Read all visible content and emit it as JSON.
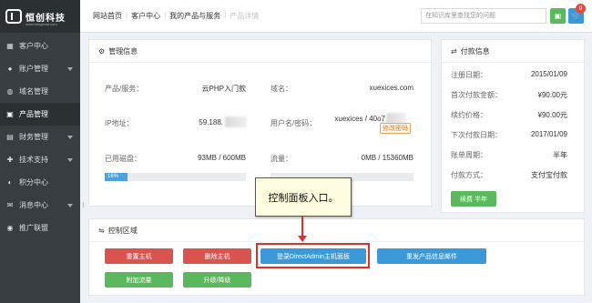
{
  "logo": {
    "title": "恒创科技",
    "subtitle": "www.henghost.com"
  },
  "nav": [
    {
      "label": "客户中心",
      "icon": "grid-icon",
      "glyph": "▦",
      "caret": false,
      "active": false
    },
    {
      "label": "账户管理",
      "icon": "user-icon",
      "glyph": "●",
      "caret": true,
      "active": false
    },
    {
      "label": "域名管理",
      "icon": "globe-icon",
      "glyph": "◍",
      "caret": false,
      "active": false
    },
    {
      "label": "产品管理",
      "icon": "box-icon",
      "glyph": "▣",
      "caret": false,
      "active": true
    },
    {
      "label": "财务管理",
      "icon": "wallet-icon",
      "glyph": "▤",
      "caret": true,
      "active": false
    },
    {
      "label": "技术支持",
      "icon": "support-icon",
      "glyph": "✚",
      "caret": true,
      "active": false
    },
    {
      "label": "积分中心",
      "icon": "points-icon",
      "glyph": "◐",
      "caret": false,
      "active": false
    },
    {
      "label": "消息中心",
      "icon": "message-icon",
      "glyph": "✉",
      "caret": true,
      "active": false
    },
    {
      "label": "推广联盟",
      "icon": "promo-icon",
      "glyph": "◉",
      "caret": false,
      "active": false
    }
  ],
  "breadcrumb": [
    "网站首页",
    "客户中心",
    "我的产品与服务",
    "产品详情"
  ],
  "search": {
    "placeholder": "在知识库里查找您的问题"
  },
  "cart_count": "0",
  "mgmt": {
    "title": "管理信息",
    "product_label": "产品/服务：",
    "product_value": "云PHP入门款",
    "domain_label": "域名：",
    "domain_value": "xuexices.com",
    "ip_label": "IP地址：",
    "ip_value": "59.188.",
    "user_label": "用户名/密码：",
    "user_value": "xuexices / 40o7",
    "change_pwd": "修改密码",
    "disk_label": "已用磁盘：",
    "disk_value": "93MB / 600MB",
    "disk_percent": 16,
    "disk_percent_text": "16%",
    "traffic_label": "流量：",
    "traffic_value": "0MB / 15360MB"
  },
  "payment": {
    "title": "付款信息",
    "rows": [
      {
        "label": "注册日期：",
        "value": "2015/01/09"
      },
      {
        "label": "首次付款金额：",
        "value": "¥90.00元"
      },
      {
        "label": "续约价格：",
        "value": "¥90.00元"
      },
      {
        "label": "下次付款日期：",
        "value": "2017/01/09"
      },
      {
        "label": "账单周期：",
        "value": "半年"
      },
      {
        "label": "付款方式：",
        "value": "支付宝付款"
      }
    ],
    "renew_button": "续费 半年"
  },
  "control": {
    "title": "控制区域",
    "buttons": {
      "reset": "重置主机",
      "delete": "删除主机",
      "directadmin": "登录DirectAdmin主机面板",
      "resend": "重发产品信息邮件",
      "traffic": "附加流量",
      "upgrade": "升级/降级"
    }
  },
  "callout": "控制面板入口。"
}
